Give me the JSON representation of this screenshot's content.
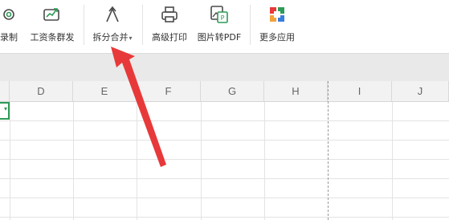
{
  "toolbar": {
    "items": [
      {
        "label": "录制",
        "icon": "record-icon"
      },
      {
        "label": "工资条群发",
        "icon": "payslip-send-icon"
      },
      {
        "label": "拆分合并",
        "icon": "split-merge-icon",
        "has_dropdown": true
      },
      {
        "label": "高级打印",
        "icon": "printer-icon"
      },
      {
        "label": "图片转PDF",
        "icon": "image-to-pdf-icon"
      },
      {
        "label": "更多应用",
        "icon": "more-apps-icon"
      }
    ],
    "dropdown_caret": "▾"
  },
  "columns": [
    "D",
    "E",
    "F",
    "G",
    "H",
    "I",
    "J"
  ],
  "cell_indicator": "▾",
  "annotation": {
    "type": "red-arrow",
    "target": "拆分合并",
    "color": "#e8393a"
  },
  "colors": {
    "accent_green": "#2e9b56",
    "arrow_red": "#e8393a"
  }
}
